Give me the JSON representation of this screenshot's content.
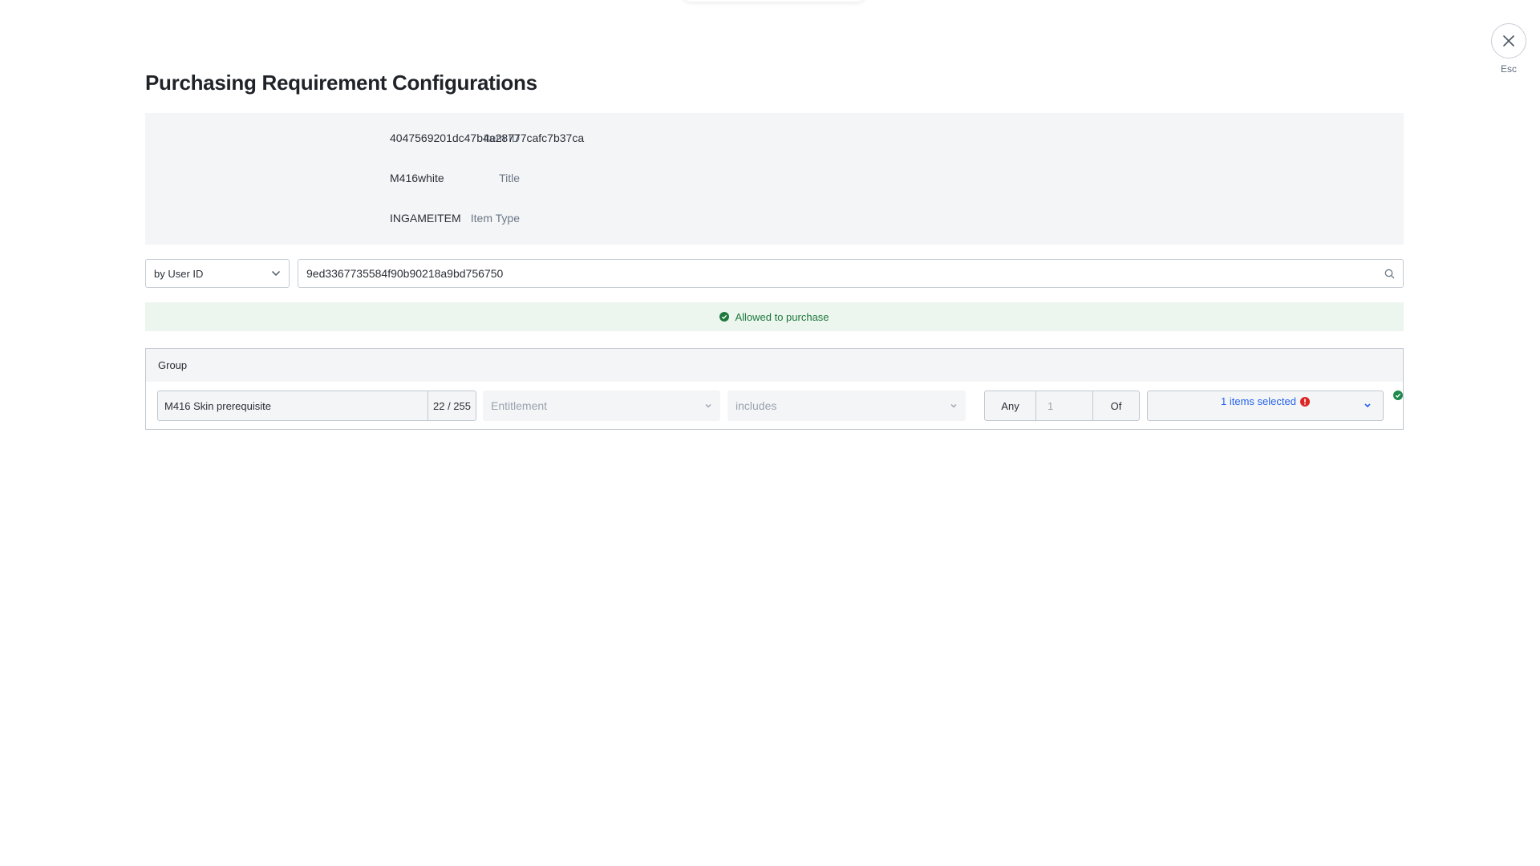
{
  "page": {
    "title": "Purchasing Requirement Configurations"
  },
  "close": {
    "icon": "close-icon",
    "label": "Esc"
  },
  "item_info": {
    "rows": [
      {
        "label": "Item ID",
        "value": "4047569201dc47b4a28777cafc7b37ca"
      },
      {
        "label": "Title",
        "value": "M416white"
      },
      {
        "label": "Item Type",
        "value": "INGAMEITEM"
      }
    ]
  },
  "lookup": {
    "type_select": {
      "selected": "by User ID",
      "icon": "chevron-down-icon"
    },
    "user_id_input": {
      "value": "9ed3367735584f90b90218a9bd756750",
      "icon": "search-icon"
    }
  },
  "status": {
    "text": "Allowed to purchase",
    "icon": "check-circle-icon",
    "color": "#1e7a3c"
  },
  "group": {
    "header": "Group",
    "requirement": {
      "name_value": "M416 Skin prerequisite",
      "char_count": "22 / 255",
      "type_select": "Entitlement",
      "operator_select": "includes",
      "any_label": "Any",
      "count_value": "1",
      "of_label": "Of",
      "items_selected": "1 items selected",
      "items_warning_icon": "error-icon",
      "items_warning_color": "#dc2626",
      "row_status_icon": "check-circle-icon",
      "row_status_color": "#1e8a4c"
    }
  }
}
